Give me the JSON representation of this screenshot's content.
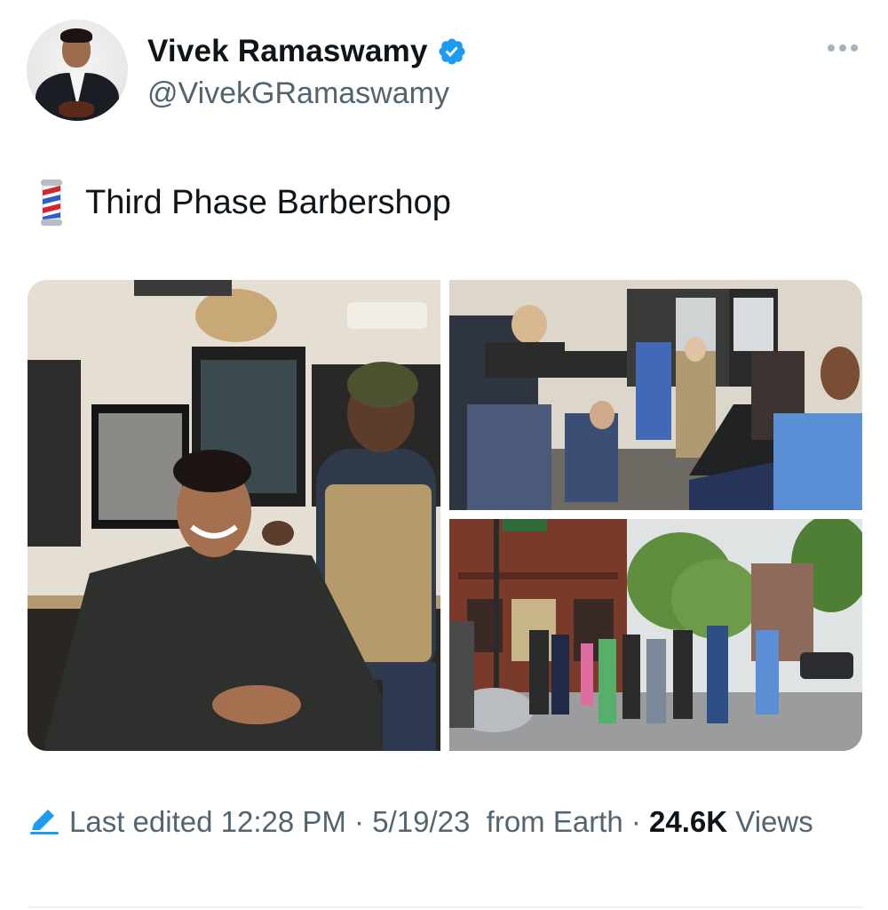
{
  "author": {
    "display_name": "Vivek Ramaswamy",
    "handle": "@VivekGRamaswamy",
    "verified": true
  },
  "tweet": {
    "emoji": "💈",
    "text": "Third Phase Barbershop"
  },
  "media": [
    {
      "subject": "barbershop-haircut-photo"
    },
    {
      "subject": "press-cameras-in-barbershop-photo"
    },
    {
      "subject": "street-corner-group-photo"
    }
  ],
  "meta": {
    "edited_label": "Last edited 12:28 PM · 5/19/23",
    "source": "from Earth",
    "separator": "·",
    "views_count": "24.6K",
    "views_label": "Views"
  },
  "colors": {
    "verified": "#1d9bf0",
    "text_primary": "#0f1419",
    "text_secondary": "#536471"
  },
  "icons": {
    "verified": "verified-badge-icon",
    "more": "more-dots-icon",
    "edit": "pencil-icon",
    "emoji": "barber-pole-icon"
  }
}
